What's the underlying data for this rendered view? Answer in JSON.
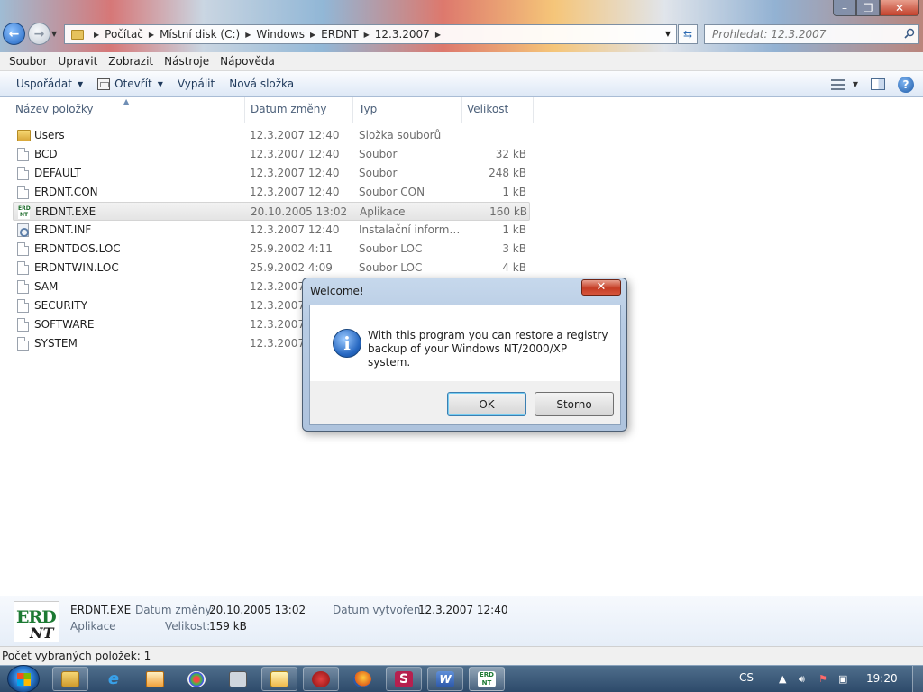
{
  "address": {
    "crumbs": [
      "Počítač",
      "Místní disk (C:)",
      "Windows",
      "ERDNT",
      "12.3.2007"
    ]
  },
  "search": {
    "placeholder": "Prohledat: 12.3.2007"
  },
  "menu": [
    "Soubor",
    "Upravit",
    "Zobrazit",
    "Nástroje",
    "Nápověda"
  ],
  "toolbar": {
    "organize": "Uspořádat",
    "open": "Otevřít",
    "burn": "Vypálit",
    "new_folder": "Nová složka"
  },
  "columns": {
    "name": "Název položky",
    "date": "Datum změny",
    "type": "Typ",
    "size": "Velikost"
  },
  "files": [
    {
      "name": "Users",
      "date": "12.3.2007 12:40",
      "type": "Složka souborů",
      "size": "",
      "icon": "folder-icon"
    },
    {
      "name": "BCD",
      "date": "12.3.2007 12:40",
      "type": "Soubor",
      "size": "32 kB",
      "icon": "file-icon"
    },
    {
      "name": "DEFAULT",
      "date": "12.3.2007 12:40",
      "type": "Soubor",
      "size": "248 kB",
      "icon": "file-icon"
    },
    {
      "name": "ERDNT.CON",
      "date": "12.3.2007 12:40",
      "type": "Soubor CON",
      "size": "1 kB",
      "icon": "file-icon"
    },
    {
      "name": "ERDNT.EXE",
      "date": "20.10.2005 13:02",
      "type": "Aplikace",
      "size": "160 kB",
      "icon": "erdnt-app-icon",
      "selected": true
    },
    {
      "name": "ERDNT.INF",
      "date": "12.3.2007 12:40",
      "type": "Instalační informa...",
      "size": "1 kB",
      "icon": "setup-info-icon"
    },
    {
      "name": "ERDNTDOS.LOC",
      "date": "25.9.2002 4:11",
      "type": "Soubor LOC",
      "size": "3 kB",
      "icon": "file-icon"
    },
    {
      "name": "ERDNTWIN.LOC",
      "date": "25.9.2002 4:09",
      "type": "Soubor LOC",
      "size": "4 kB",
      "icon": "file-icon"
    },
    {
      "name": "SAM",
      "date": "12.3.2007 1",
      "type": "",
      "size": "",
      "icon": "file-icon"
    },
    {
      "name": "SECURITY",
      "date": "12.3.2007 1",
      "type": "",
      "size": "",
      "icon": "file-icon"
    },
    {
      "name": "SOFTWARE",
      "date": "12.3.2007 1",
      "type": "",
      "size": "",
      "icon": "file-icon"
    },
    {
      "name": "SYSTEM",
      "date": "12.3.2007 1",
      "type": "",
      "size": "",
      "icon": "file-icon"
    }
  ],
  "details": {
    "thumb_top": "ERD",
    "thumb_bottom": "NT",
    "filename": "ERDNT.EXE",
    "kind": "Aplikace",
    "modified_label": "Datum změny:",
    "modified_value": "20.10.2005 13:02",
    "size_label": "Velikost:",
    "size_value": "159 kB",
    "created_label": "Datum vytvoření:",
    "created_value": "12.3.2007 12:40"
  },
  "status": "Počet vybraných položek: 1",
  "taskbar": {
    "lang": "CS",
    "clock": "19:20"
  },
  "dialog": {
    "title": "Welcome!",
    "message_line1": "With this program you can restore a registry",
    "message_line2": "backup of your Windows NT/2000/XP system.",
    "ok": "OK",
    "cancel": "Storno"
  },
  "colors": {
    "accent": "#1e395b",
    "selection": "#e4e4e4",
    "erd_green": "#1d7a33",
    "dialog_frame": "#b7cbe3",
    "close_red": "#c53d25"
  }
}
